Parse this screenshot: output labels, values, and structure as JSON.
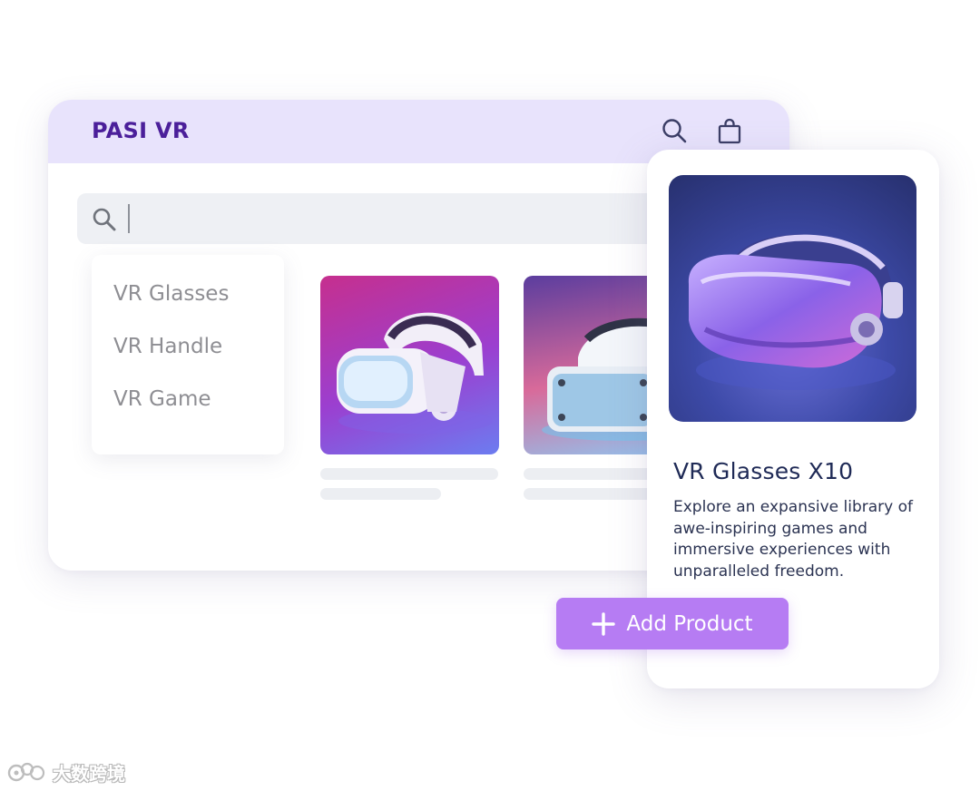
{
  "header": {
    "brand": "PASI VR",
    "search_icon": "search-icon",
    "cart_icon": "shopping-bag-icon"
  },
  "search": {
    "value": "",
    "icon": "search-icon"
  },
  "dropdown": {
    "items": [
      {
        "label": "VR Glasses"
      },
      {
        "label": "VR Handle"
      },
      {
        "label": "VR Game"
      }
    ]
  },
  "product_grid": {
    "thumbnails": [
      {
        "icon": "vr-headset-image"
      },
      {
        "icon": "vr-headset-image"
      }
    ]
  },
  "product_card": {
    "title": "VR Glasses X10",
    "description": "Explore an expansive library of awe-inspiring games and immersive experiences with unparalleled freedom.",
    "image": "vr-glasses-image"
  },
  "add_button": {
    "label": "Add Product",
    "icon": "plus-icon"
  },
  "watermark": {
    "text": "大数跨境"
  },
  "colors": {
    "header_bg": "#e8e3fc",
    "brand": "#4b1f9a",
    "accent": "#b67cf3",
    "title": "#1f2a56"
  }
}
